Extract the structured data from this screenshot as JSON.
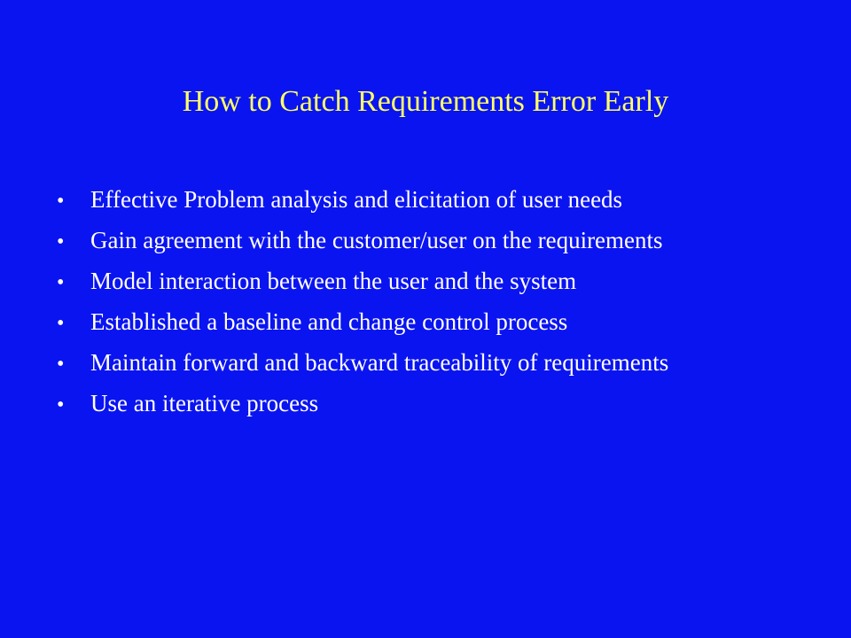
{
  "slide": {
    "title": "How to Catch Requirements Error Early",
    "bullet_glyph": "•",
    "bullets": [
      "Effective Problem analysis and elicitation of user needs",
      "Gain agreement with the customer/user on the requirements",
      "Model interaction between the user and the system",
      "Established a baseline and change control process",
      "Maintain forward and backward traceability of requirements",
      "Use an iterative process"
    ]
  },
  "colors": {
    "background": "#0A14F0",
    "title": "#FFFF66",
    "body_text": "#FFFFFF"
  }
}
